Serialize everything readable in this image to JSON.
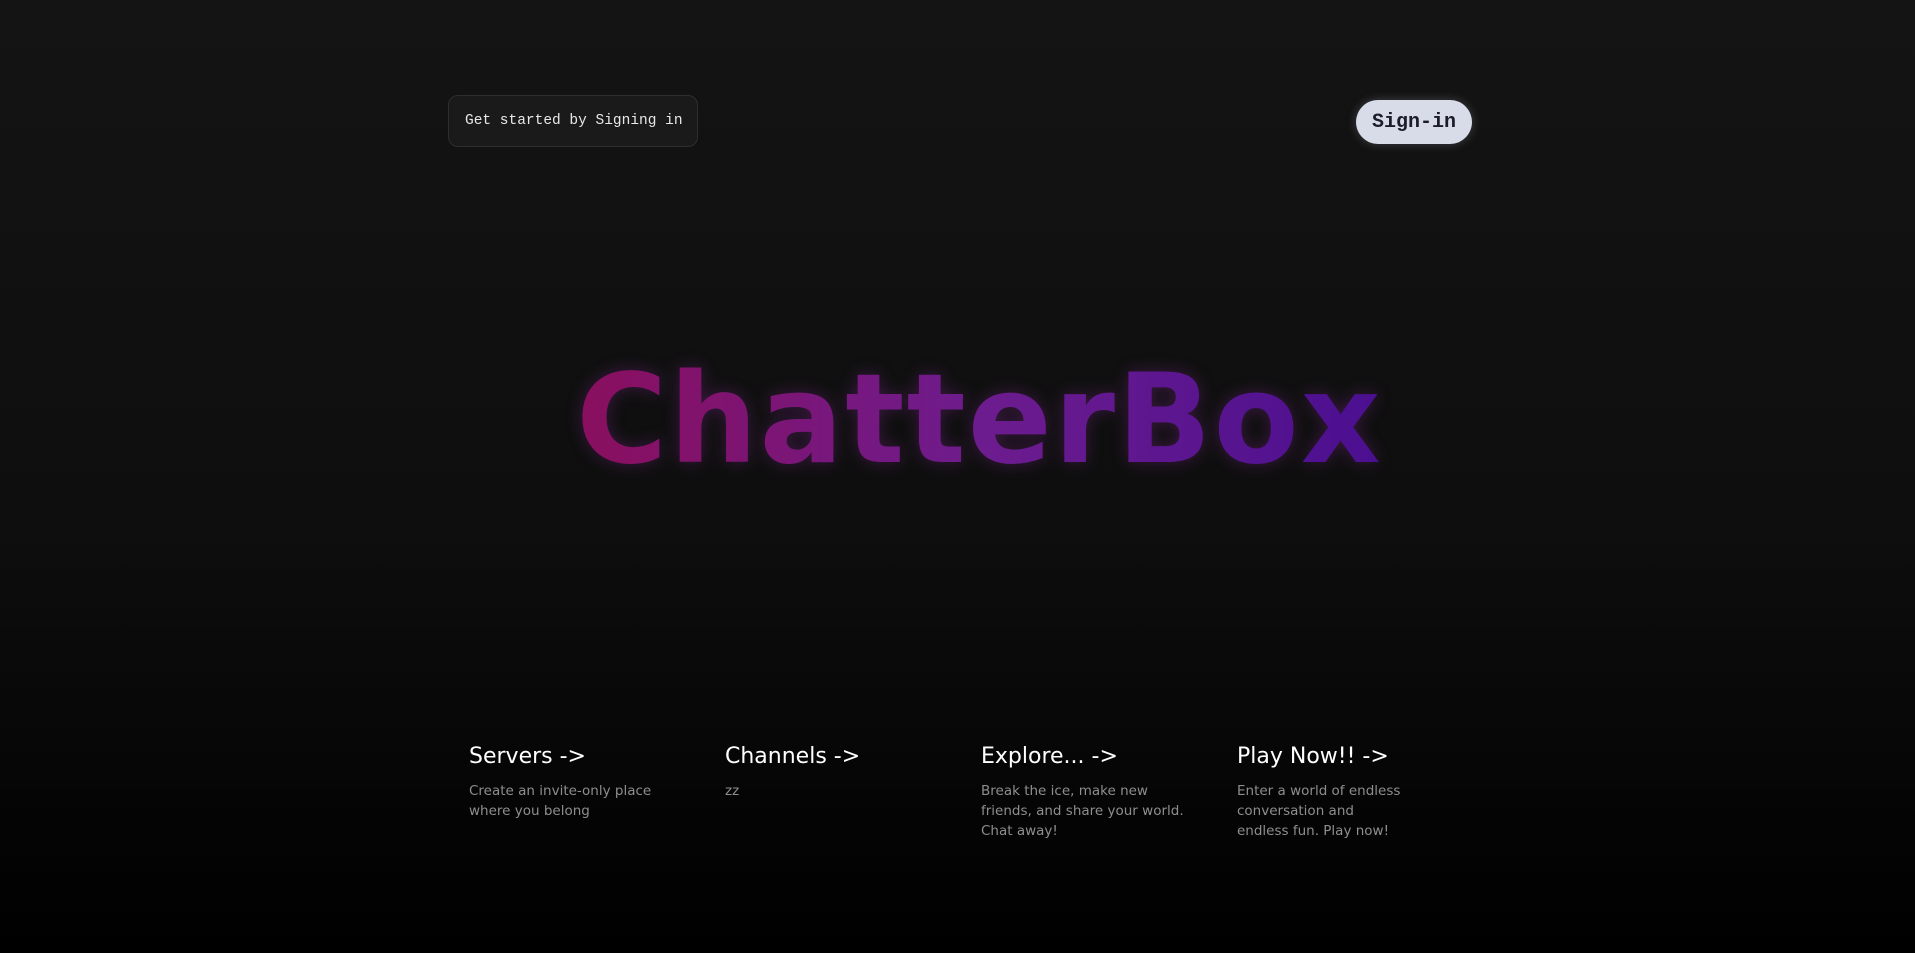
{
  "header": {
    "intro_text": "Get started by Signing in",
    "signin_label": "Sign-in"
  },
  "hero": {
    "brand": "ChatterBox"
  },
  "cards": [
    {
      "title": "Servers ->",
      "description": "Create an invite-only place where you belong"
    },
    {
      "title": "Channels ->",
      "description": "zz"
    },
    {
      "title": "Explore... ->",
      "description": "Break the ice, make new friends, and share your world. Chat away!"
    },
    {
      "title": "Play Now!! ->",
      "description": "Enter a world of endless conversation and endless fun. Play now!"
    }
  ],
  "colors": {
    "brand_gradient_start": "#8a0f5e",
    "brand_gradient_end": "#4a0f90",
    "signin_bg": "#d8dbe8"
  }
}
